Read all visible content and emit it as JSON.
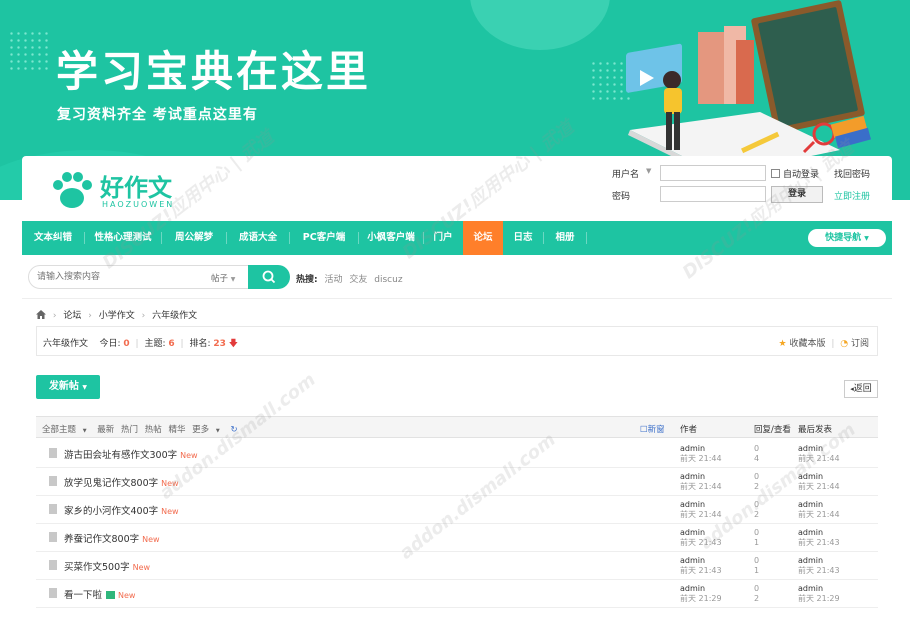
{
  "banner": {
    "title": "学习宝典在这里",
    "subtitle": "复习资料齐全 考试重点这里有"
  },
  "logo": {
    "text": "好作文",
    "sub": "HAOZUOWEN"
  },
  "login": {
    "username_label": "用户名",
    "password_label": "密码",
    "auto_login_label": "自动登录",
    "find_password": "找回密码",
    "login_button": "登录",
    "register": "立即注册"
  },
  "nav": {
    "items": [
      {
        "label": "文本纠错"
      },
      {
        "label": "性格心理测试"
      },
      {
        "label": "周公解梦"
      },
      {
        "label": "成语大全"
      },
      {
        "label": "PC客户端"
      },
      {
        "label": "小枫客户端"
      },
      {
        "label": "门户"
      },
      {
        "label": "论坛"
      },
      {
        "label": "日志"
      },
      {
        "label": "相册"
      }
    ],
    "active_index": 7,
    "quick_nav": "快捷导航"
  },
  "search": {
    "placeholder": "请输入搜索内容",
    "type": "帖子",
    "hot_label": "热搜:",
    "hot_terms": [
      "活动",
      "交友",
      "discuz"
    ]
  },
  "breadcrumb": [
    "论坛",
    "小学作文",
    "六年级作文"
  ],
  "forum": {
    "name": "六年级作文",
    "today_label": "今日:",
    "today": "0",
    "threads_label": "主题:",
    "threads": "6",
    "rank_label": "排名:",
    "rank": "23",
    "favorite": "收藏本版",
    "subscribe": "订阅"
  },
  "actions": {
    "new_post": "发新帖",
    "back": "返回"
  },
  "thread_header": {
    "filters": [
      "全部主题",
      "最新",
      "热门",
      "热帖",
      "精华",
      "更多"
    ],
    "new_window": "新窗",
    "author": "作者",
    "replies_views": "回复/查看",
    "last_post": "最后发表"
  },
  "threads": [
    {
      "title": "游古田会址有感作文300字",
      "badge": "New",
      "author": "admin",
      "date": "前天 21:44",
      "replies": "0",
      "views": "4",
      "last_user": "admin",
      "last_time": "前天 21:44",
      "has_image": false
    },
    {
      "title": "放学见鬼记作文800字",
      "badge": "New",
      "author": "admin",
      "date": "前天 21:44",
      "replies": "0",
      "views": "2",
      "last_user": "admin",
      "last_time": "前天 21:44",
      "has_image": false
    },
    {
      "title": "家乡的小河作文400字",
      "badge": "New",
      "author": "admin",
      "date": "前天 21:44",
      "replies": "0",
      "views": "2",
      "last_user": "admin",
      "last_time": "前天 21:44",
      "has_image": false
    },
    {
      "title": "养蚕记作文800字",
      "badge": "New",
      "author": "admin",
      "date": "前天 21:43",
      "replies": "0",
      "views": "1",
      "last_user": "admin",
      "last_time": "前天 21:43",
      "has_image": false
    },
    {
      "title": "买菜作文500字",
      "badge": "New",
      "author": "admin",
      "date": "前天 21:43",
      "replies": "0",
      "views": "1",
      "last_user": "admin",
      "last_time": "前天 21:43",
      "has_image": false
    },
    {
      "title": "看一下啦",
      "badge": "New",
      "author": "admin",
      "date": "前天 21:29",
      "replies": "0",
      "views": "2",
      "last_user": "admin",
      "last_time": "前天 21:29",
      "has_image": true
    }
  ],
  "watermark": {
    "text": "DISCUZ!应用中心 | 武道",
    "url": "addon.dismall.com"
  },
  "colors": {
    "accent": "#1ec4a2",
    "active_nav": "#ff7f2a",
    "highlight": "#f26c4f"
  }
}
